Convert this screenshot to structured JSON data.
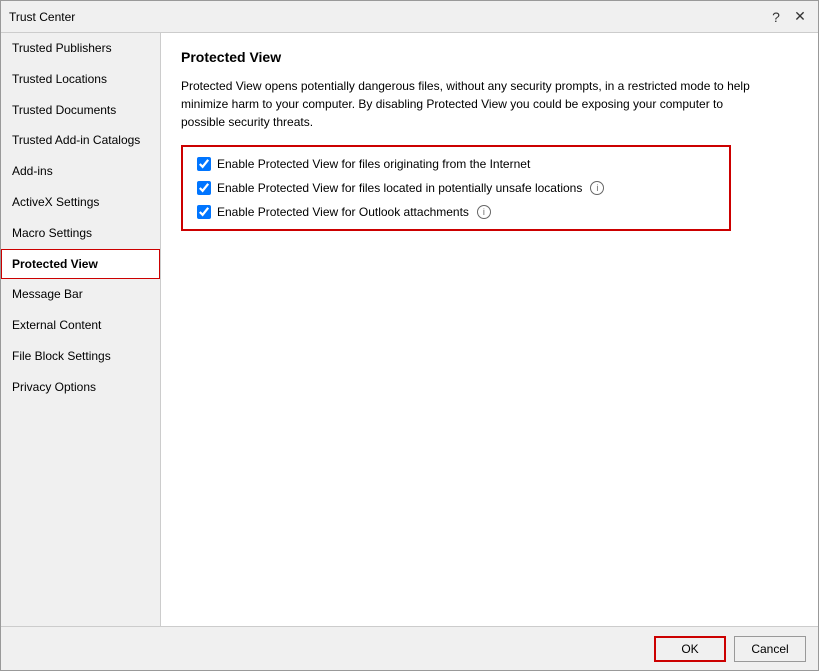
{
  "window": {
    "title": "Trust Center",
    "help_icon": "?",
    "close_icon": "✕"
  },
  "sidebar": {
    "items": [
      {
        "id": "trusted-publishers",
        "label": "Trusted Publishers",
        "active": false
      },
      {
        "id": "trusted-locations",
        "label": "Trusted Locations",
        "active": false
      },
      {
        "id": "trusted-documents",
        "label": "Trusted Documents",
        "active": false
      },
      {
        "id": "trusted-add-in-catalogs",
        "label": "Trusted Add-in Catalogs",
        "active": false
      },
      {
        "id": "add-ins",
        "label": "Add-ins",
        "active": false
      },
      {
        "id": "activex-settings",
        "label": "ActiveX Settings",
        "active": false
      },
      {
        "id": "macro-settings",
        "label": "Macro Settings",
        "active": false
      },
      {
        "id": "protected-view",
        "label": "Protected View",
        "active": true
      },
      {
        "id": "message-bar",
        "label": "Message Bar",
        "active": false
      },
      {
        "id": "external-content",
        "label": "External Content",
        "active": false
      },
      {
        "id": "file-block-settings",
        "label": "File Block Settings",
        "active": false
      },
      {
        "id": "privacy-options",
        "label": "Privacy Options",
        "active": false
      }
    ]
  },
  "content": {
    "title": "Protected View",
    "description": "Protected View opens potentially dangerous files, without any security prompts, in a restricted mode to help minimize harm to your computer. By disabling Protected View you could be exposing your computer to possible security threats.",
    "checkboxes": [
      {
        "id": "check-internet",
        "label": "Enable Protected View for files originating from the Internet",
        "checked": true,
        "has_info": false
      },
      {
        "id": "check-unsafe-locations",
        "label": "Enable Protected View for files located in potentially unsafe locations",
        "checked": true,
        "has_info": true
      },
      {
        "id": "check-outlook",
        "label": "Enable Protected View for Outlook attachments",
        "checked": true,
        "has_info": true
      }
    ]
  },
  "footer": {
    "ok_label": "OK",
    "cancel_label": "Cancel"
  }
}
